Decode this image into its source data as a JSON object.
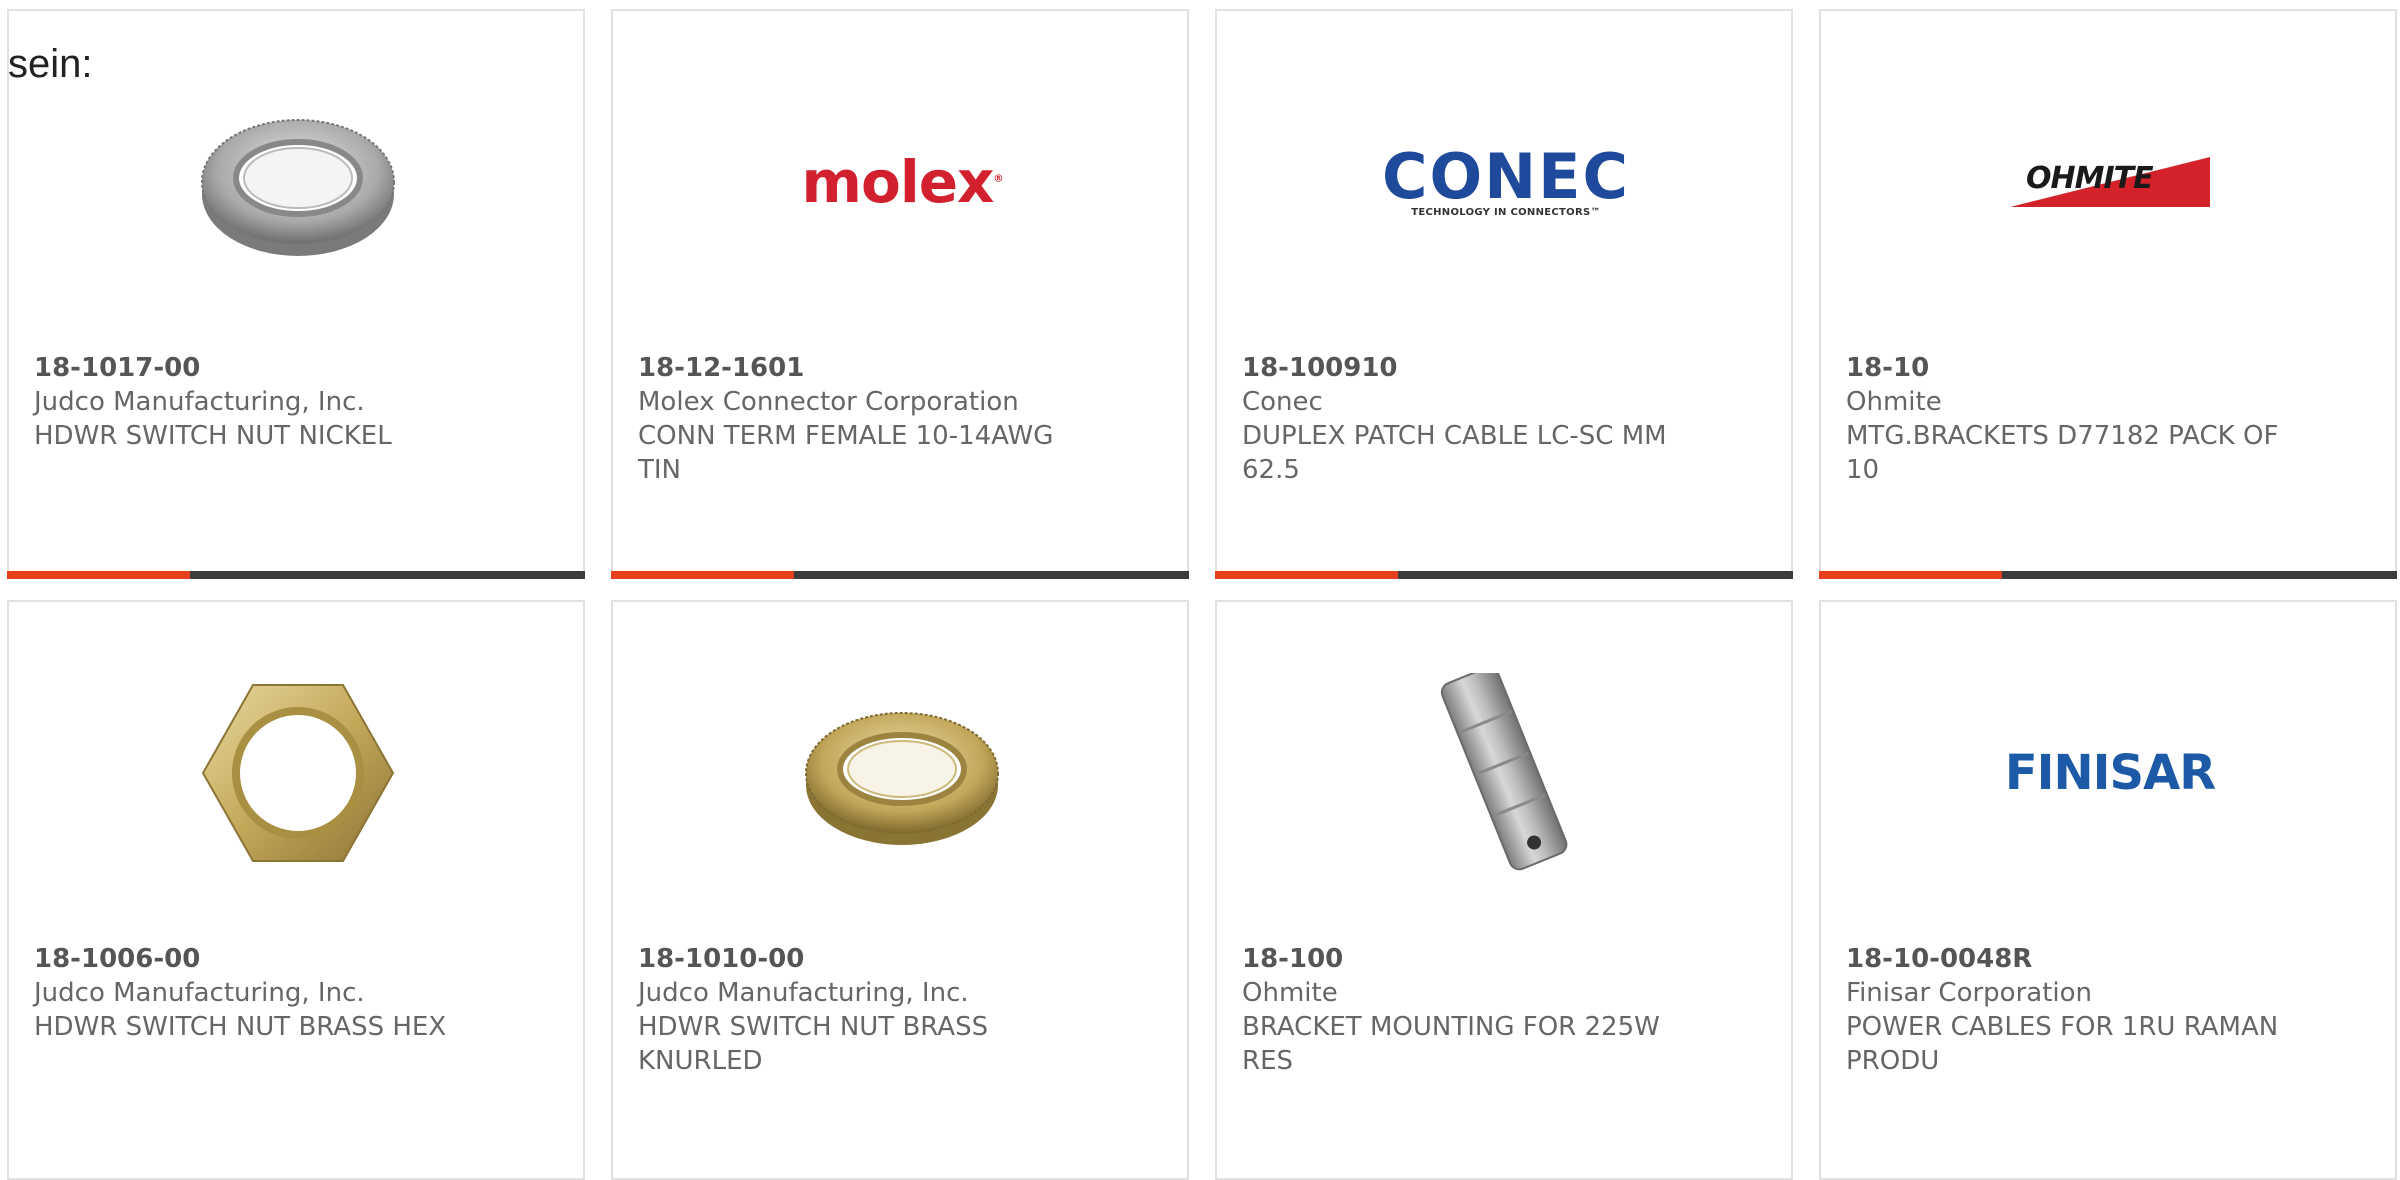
{
  "page": {
    "top_label": "sein:"
  },
  "colors": {
    "accent": "#e8401c",
    "bar_dark": "#3c3c3c",
    "card_border": "#e1e1e1",
    "text": "#666666"
  },
  "products": [
    {
      "part_number": "18-1017-00",
      "manufacturer": "Judco Manufacturing, Inc.",
      "description_line1": "HDWR SWITCH NUT NICKEL",
      "description_line2": "",
      "image": "knurled-nut-nickel-icon"
    },
    {
      "part_number": "18-12-1601",
      "manufacturer": "Molex Connector Corporation",
      "description_line1": "CONN TERM FEMALE 10-14AWG",
      "description_line2": "TIN",
      "image": "molex-logo",
      "logo_text": "molex"
    },
    {
      "part_number": "18-100910",
      "manufacturer": "Conec",
      "description_line1": "DUPLEX PATCH CABLE LC-SC MM",
      "description_line2": "62.5",
      "image": "conec-logo",
      "logo_text": "CONEC",
      "logo_subtext": "TECHNOLOGY IN CONNECTORS™"
    },
    {
      "part_number": "18-10",
      "manufacturer": "Ohmite",
      "description_line1": "MTG.BRACKETS D77182 PACK OF",
      "description_line2": "10",
      "image": "ohmite-logo",
      "logo_text": "OHMITE"
    },
    {
      "part_number": "18-1006-00",
      "manufacturer": "Judco Manufacturing, Inc.",
      "description_line1": "HDWR SWITCH NUT BRASS HEX",
      "description_line2": "",
      "image": "hex-nut-brass-icon"
    },
    {
      "part_number": "18-1010-00",
      "manufacturer": "Judco Manufacturing, Inc.",
      "description_line1": "HDWR SWITCH NUT BRASS",
      "description_line2": "KNURLED",
      "image": "knurled-nut-brass-icon"
    },
    {
      "part_number": "18-100",
      "manufacturer": "Ohmite",
      "description_line1": "BRACKET MOUNTING FOR 225W",
      "description_line2": "RES",
      "image": "mounting-bracket-icon"
    },
    {
      "part_number": "18-10-0048R",
      "manufacturer": "Finisar Corporation",
      "description_line1": "POWER CABLES FOR 1RU RAMAN",
      "description_line2": "PRODU",
      "image": "finisar-logo",
      "logo_text": "FINISAR"
    }
  ]
}
